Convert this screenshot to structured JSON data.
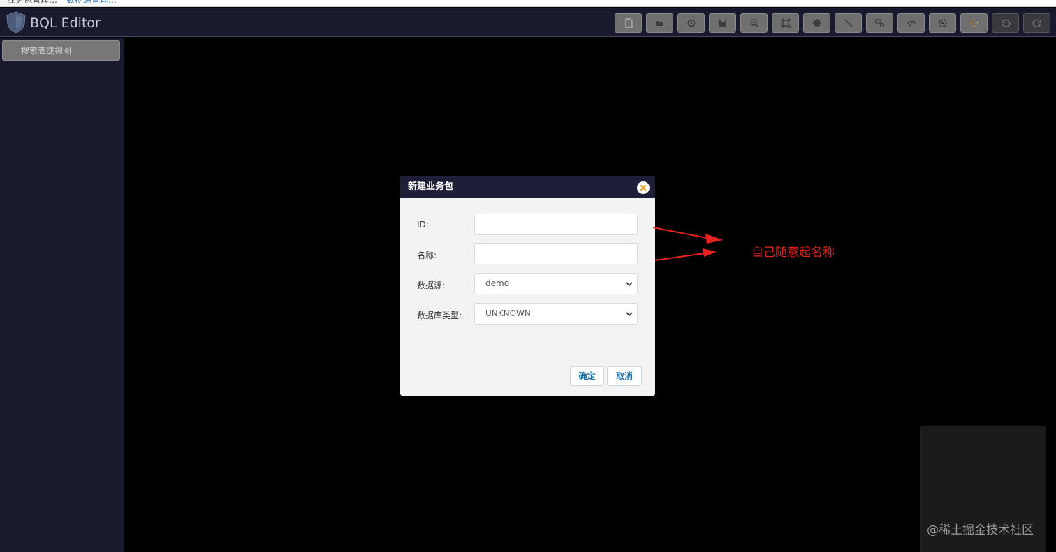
{
  "tabs": [
    {
      "label": "业务包管理…"
    },
    {
      "label": "数据源管理…"
    }
  ],
  "header": {
    "title": "BQL Editor"
  },
  "toolbar": {
    "buttons": [
      {
        "icon": "new-file-icon"
      },
      {
        "icon": "open-folder-icon"
      },
      {
        "icon": "settings-icon"
      },
      {
        "icon": "save-icon"
      },
      {
        "icon": "zoom-out-icon"
      },
      {
        "icon": "fit-screen-icon"
      },
      {
        "icon": "layout-icon"
      },
      {
        "icon": "line-tool-icon"
      },
      {
        "icon": "relation-icon"
      },
      {
        "icon": "hide-icon"
      },
      {
        "icon": "gear-icon"
      },
      {
        "icon": "move-icon"
      },
      {
        "icon": "undo-icon"
      },
      {
        "icon": "redo-icon"
      }
    ]
  },
  "sidebar": {
    "search_placeholder": "搜索表或视图"
  },
  "dialog": {
    "title": "新建业务包",
    "fields": [
      {
        "label": "ID:",
        "value": ""
      },
      {
        "label": "名称:",
        "value": ""
      },
      {
        "label": "数据源:",
        "value": "demo"
      },
      {
        "label": "数据库类型:",
        "value": "UNKNOWN"
      }
    ],
    "ok_label": "确定",
    "cancel_label": "取消"
  },
  "annotation": {
    "text": "自己随意起名称",
    "color": "#e8231d"
  },
  "watermark": "@稀土掘金技术社区",
  "colors": {
    "header_bg": "#1a1a2e",
    "dialog_header_bg": "#1e1e38",
    "close_icon": "#f0a020",
    "button_text": "#1d6fa8"
  }
}
